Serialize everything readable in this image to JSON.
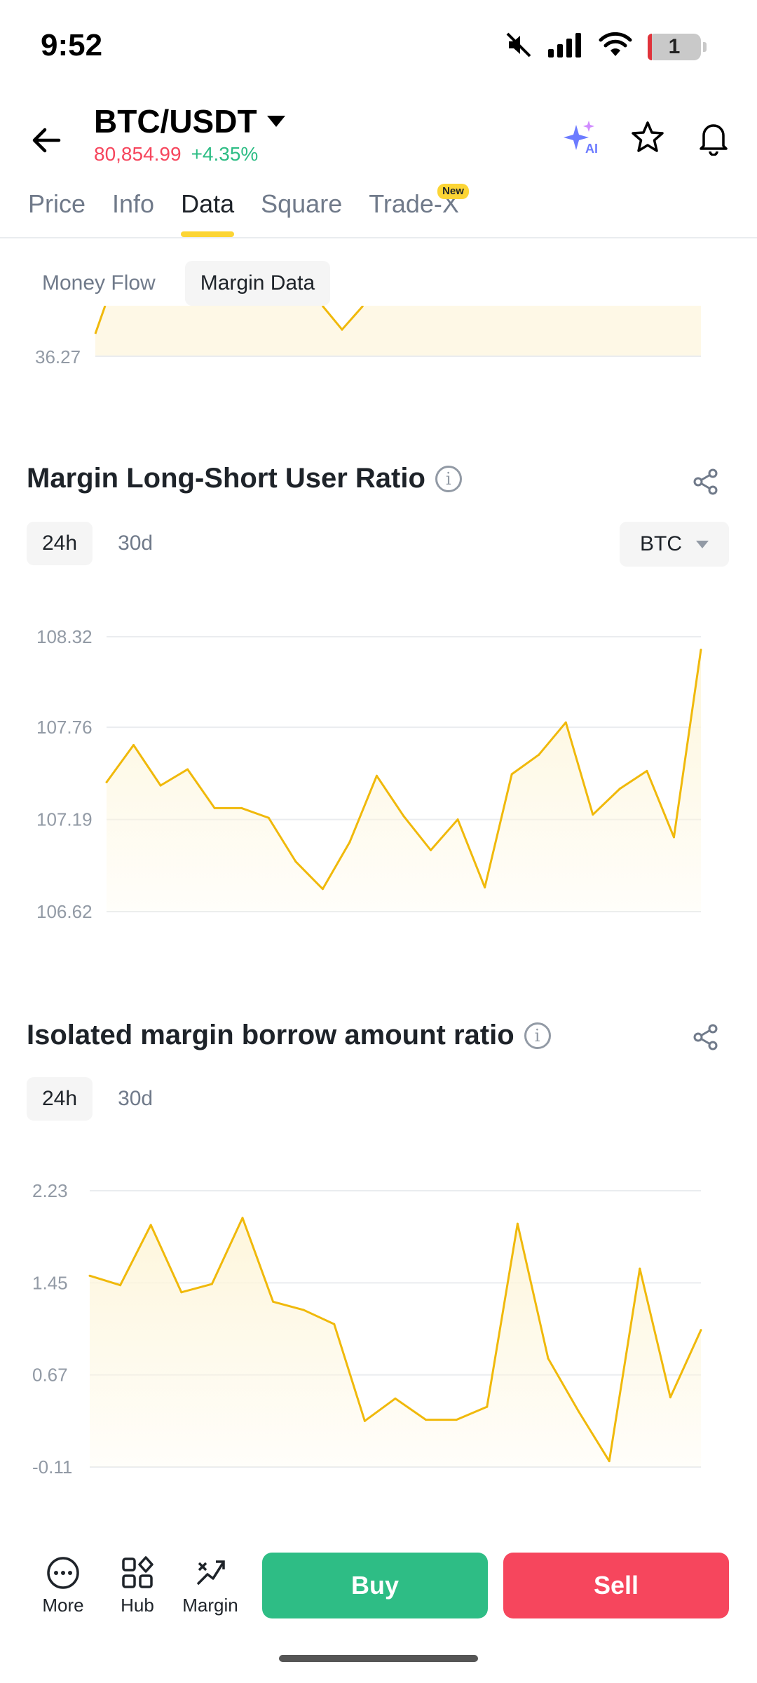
{
  "status_bar": {
    "time": "9:52",
    "battery_level": "1",
    "icons": [
      "mute-icon",
      "signal-icon",
      "wifi-icon",
      "battery-icon"
    ]
  },
  "header": {
    "pair": "BTC/USDT",
    "last_price": "80,854.99",
    "change_pct": "+4.35%",
    "ai_label": "AI",
    "icons": [
      "back-arrow-icon",
      "ai-sparkle-icon",
      "star-icon",
      "bell-icon"
    ]
  },
  "tabs": [
    {
      "label": "Price",
      "active": false
    },
    {
      "label": "Info",
      "active": false
    },
    {
      "label": "Data",
      "active": true
    },
    {
      "label": "Square",
      "active": false
    },
    {
      "label": "Trade-X",
      "active": false,
      "badge": "New"
    }
  ],
  "subtabs": [
    {
      "label": "Money Flow",
      "active": false
    },
    {
      "label": "Margin Data",
      "active": true
    }
  ],
  "partial_chart": {
    "bottom_label": "36.27"
  },
  "long_short_section": {
    "title": "Margin Long-Short User Ratio",
    "periods": [
      {
        "label": "24h",
        "active": true
      },
      {
        "label": "30d",
        "active": false
      }
    ],
    "coin": "BTC"
  },
  "isolated_section": {
    "title": "Isolated margin borrow amount ratio",
    "periods": [
      {
        "label": "24h",
        "active": true
      },
      {
        "label": "30d",
        "active": false
      }
    ]
  },
  "colors": {
    "line": "#f0b90b",
    "fill": "#fef6dc",
    "grid": "#eaecef",
    "buy": "#2ebd85",
    "sell": "#f6465d",
    "accent": "#fcd535"
  },
  "chart_data": [
    {
      "type": "area",
      "title": "Margin Long-Short User Ratio",
      "ytick_labels": [
        "108.32",
        "107.76",
        "107.19",
        "106.62"
      ],
      "yticks": [
        108.32,
        107.76,
        107.19,
        106.62
      ],
      "ylim": [
        106.62,
        108.32
      ],
      "grid": true,
      "values": [
        107.42,
        107.65,
        107.4,
        107.5,
        107.26,
        107.26,
        107.2,
        106.93,
        106.76,
        107.05,
        107.46,
        107.21,
        107.0,
        107.19,
        106.77,
        107.47,
        107.59,
        107.79,
        107.22,
        107.38,
        107.49,
        107.08,
        108.24
      ]
    },
    {
      "type": "area",
      "title": "Isolated margin borrow amount ratio",
      "ytick_labels": [
        "2.23",
        "1.45",
        "0.67",
        "-0.11"
      ],
      "yticks": [
        2.23,
        1.45,
        0.67,
        -0.11
      ],
      "ylim": [
        -0.11,
        2.23
      ],
      "grid": true,
      "values": [
        1.51,
        1.43,
        1.94,
        1.37,
        1.44,
        2.0,
        1.29,
        1.22,
        1.1,
        0.28,
        0.47,
        0.29,
        0.29,
        0.4,
        1.95,
        0.81,
        0.36,
        -0.06,
        1.57,
        0.48,
        1.05
      ]
    }
  ],
  "bottom_bar": {
    "more_label": "More",
    "hub_label": "Hub",
    "margin_label": "Margin",
    "buy_label": "Buy",
    "sell_label": "Sell"
  }
}
